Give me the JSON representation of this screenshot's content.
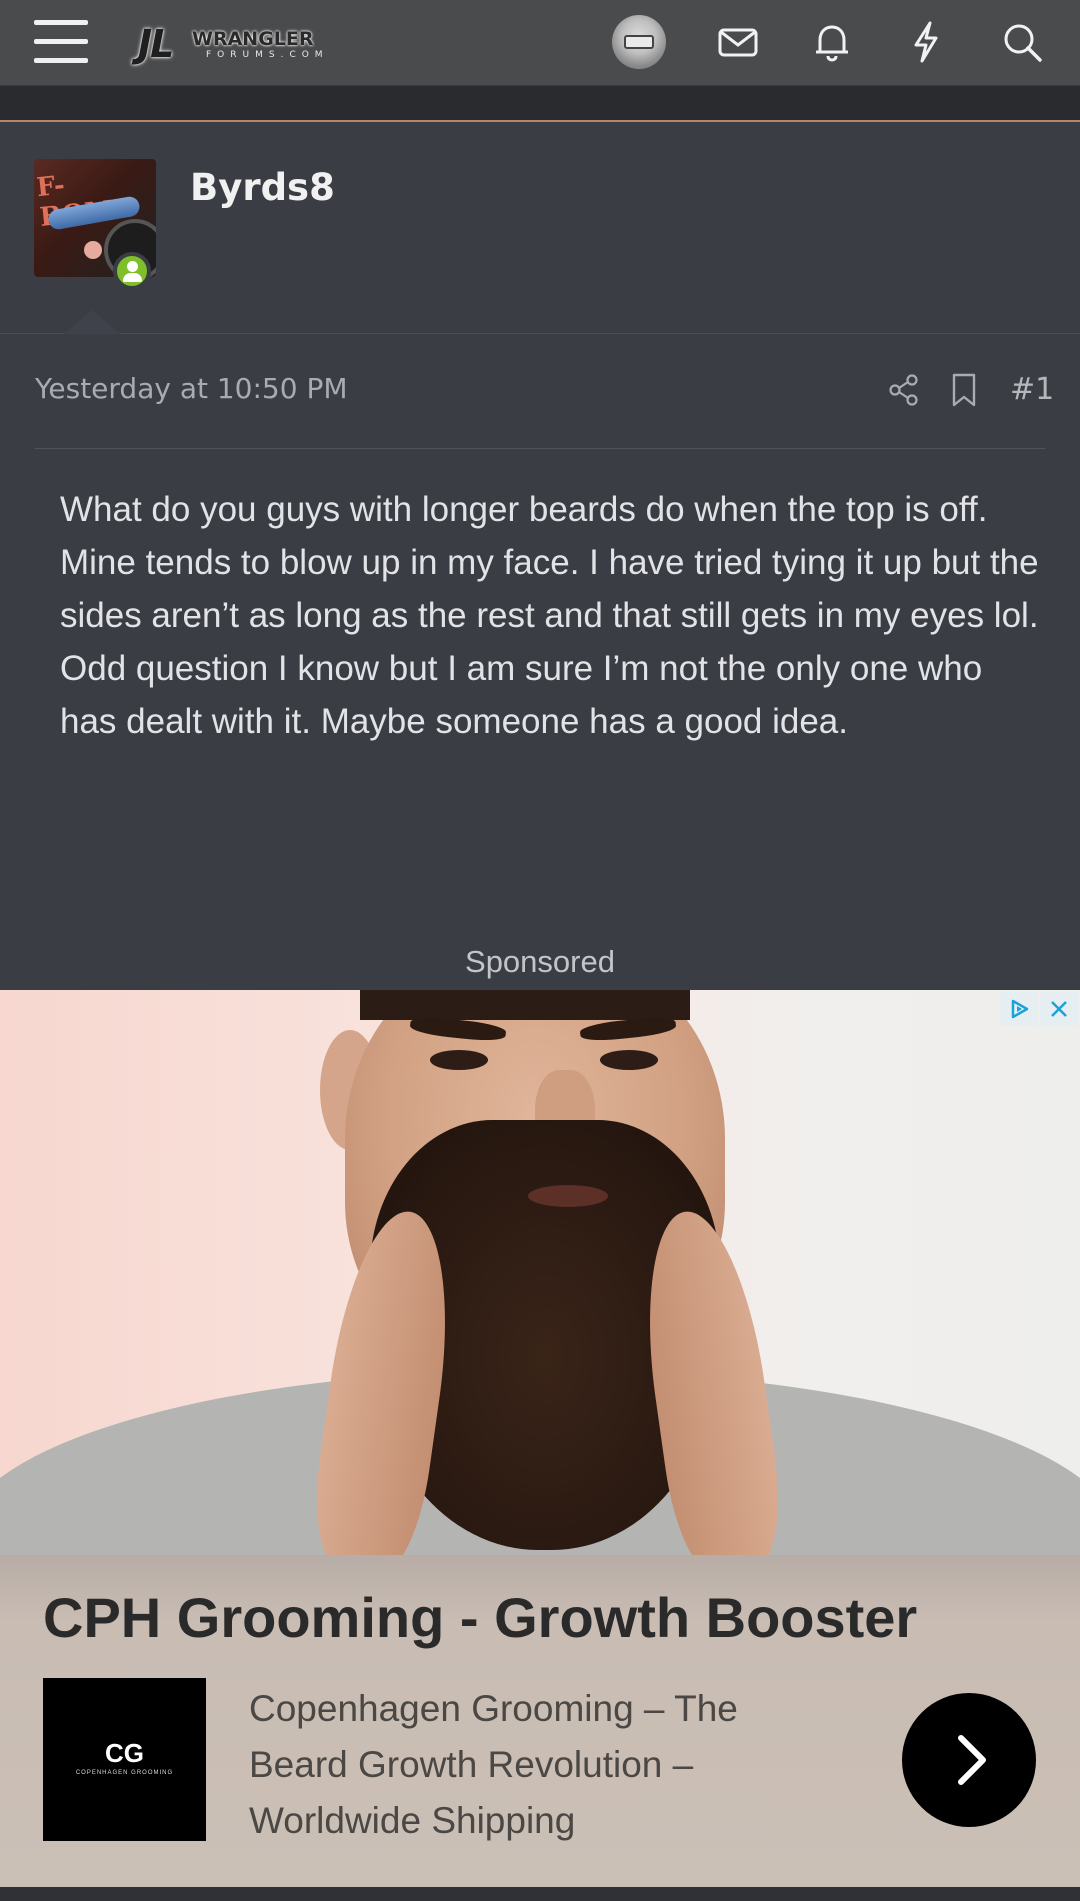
{
  "header": {
    "logo_text": "JL",
    "logo_word": "WRANGLER",
    "logo_sub": "FORUMS.COM",
    "icons": [
      "menu-icon",
      "avatar",
      "mail-icon",
      "bell-icon",
      "lightning-icon",
      "search-icon"
    ]
  },
  "post": {
    "username": "Byrds8",
    "avatar_text": "F-BOMB",
    "timestamp": "Yesterday at 10:50 PM",
    "post_number": "#1",
    "body": "What do you guys with longer beards do when the top is off. Mine tends to blow up in my face. I have tried tying it up but the sides aren’t as long as the rest and that still gets in my eyes lol. Odd question I know but I am sure I’m not the only one who has dealt with it. Maybe someone has a good idea."
  },
  "ad": {
    "label": "Sponsored",
    "title": "CPH Grooming - Growth Booster",
    "logo_initials": "CG",
    "logo_subtext": "COPENHAGEN GROOMING",
    "description": "Copenhagen Grooming – The Beard Growth Revolution – Worldwide Shipping"
  },
  "colors": {
    "header_bg": "#4a4b4d",
    "page_bg": "#3a3d44",
    "accent_line": "#b5876a",
    "online_green": "#7fbf2a"
  }
}
